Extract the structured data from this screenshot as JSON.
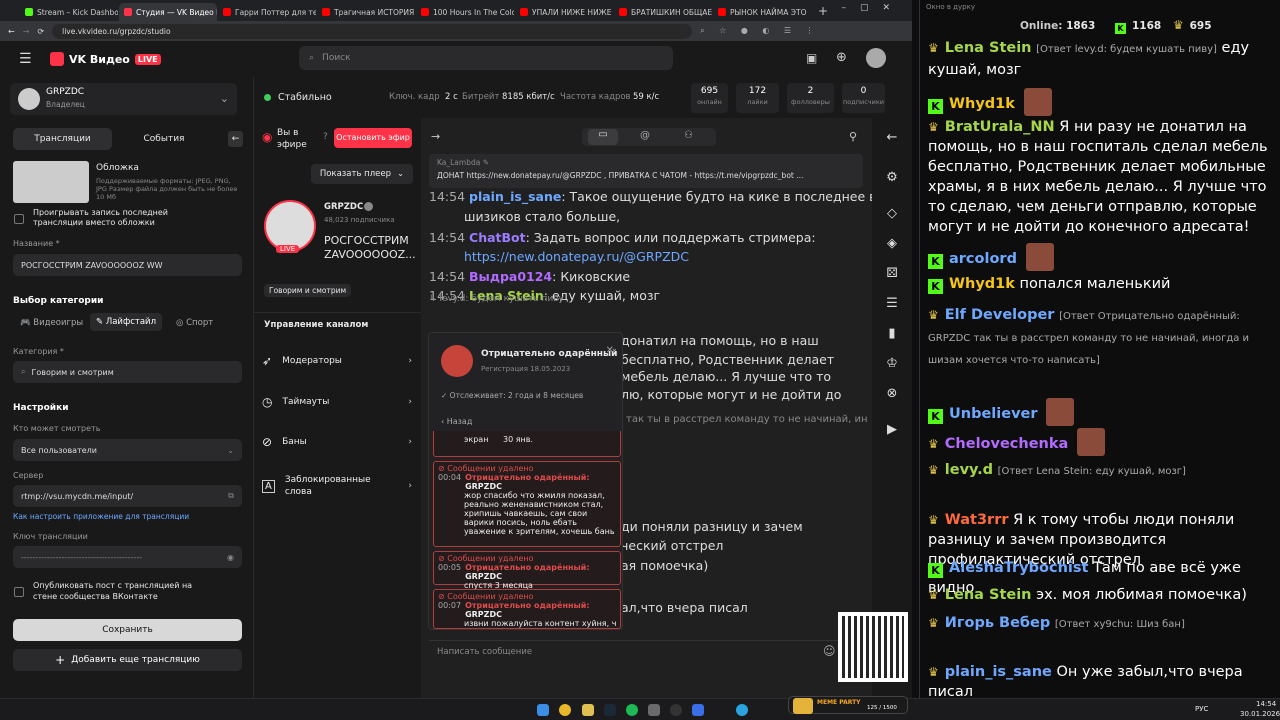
{
  "browser": {
    "tabs": [
      {
        "label": "Stream – Kick Dashboard",
        "color": "#53fc18"
      },
      {
        "label": "Студия — VK Видео Live",
        "color": "#ff3347",
        "active": true
      },
      {
        "label": "Гарри Поттер для тех",
        "color": "#ff0000"
      },
      {
        "label": "Трагичная ИСТОРИЯ",
        "color": "#ff0000"
      },
      {
        "label": "100 Hours In The Colds",
        "color": "#ff0000"
      },
      {
        "label": "УПАЛИ НИЖЕ НИЖЕ",
        "color": "#ff0000"
      },
      {
        "label": "БРАТИШКИН ОБЩАЕ",
        "color": "#ff0000"
      },
      {
        "label": "РЫНОК НАЙМА ЭТО",
        "color": "#ff0000"
      }
    ],
    "url": "live.vkvideo.ru/grpzdc/studio"
  },
  "header": {
    "logo": "VK Видео",
    "live": "LIVE",
    "search_placeholder": "Поиск"
  },
  "owner": {
    "name": "GRPZDC",
    "role": "Владелец"
  },
  "left": {
    "tab_streams": "Трансляции",
    "tab_events": "События",
    "cover_title": "Обложка",
    "cover_hint": "Поддерживаемые форматы: JPEG, PNG, JPG Размер файла должен быть не более 10 Мб",
    "replay_checkbox": "Проигрывать запись последней трансляции вместо обложки",
    "name_label": "Название *",
    "name_value": "РОСГОССТРИМ ZAVOOOOOOZ WW",
    "category_section": "Выбор категории",
    "cat_games": "Видеоигры",
    "cat_life": "Лайфстайл",
    "cat_sport": "Спорт",
    "category_label": "Категория *",
    "category_value": "Говорим и смотрим",
    "settings": "Настройки",
    "who_label": "Кто может смотреть",
    "who_value": "Все пользователи",
    "server_label": "Сервер",
    "server_value": "rtmp://vsu.mycdn.me/input/",
    "setup_link": "Как настроить приложение для трансляции",
    "key_label": "Ключ трансляции",
    "key_value": "------------------------------------------",
    "publish_checkbox": "Опубликовать пост с трансляцией на стене сообщества ВКонтакте",
    "save": "Сохранить",
    "add_stream": "Добавить еще трансляцию"
  },
  "status": {
    "state": "Стабильно",
    "keyframe_label": "Ключ. кадр",
    "keyframe_value": "2 с",
    "bitrate_label": "Битрейт",
    "bitrate_value": "8185 кбит/с",
    "fps_label": "Частота кадров",
    "fps_value": "59 к/с",
    "stats": [
      {
        "value": "695",
        "label": "онлайн"
      },
      {
        "value": "172",
        "label": "лайки"
      },
      {
        "value": "2",
        "label": "фолловеры"
      },
      {
        "value": "0",
        "label": "подписчики"
      }
    ]
  },
  "mid": {
    "on_air": "Вы в эфире",
    "stop": "Остановить эфир",
    "show_player": "Показать плеер",
    "channel": "GRPZDC",
    "subs": "48,023 подписчика",
    "title": "РОСГОССТРИМ ZAVOOOOOOZ...",
    "category": "Говорим и смотрим",
    "manage": "Управление каналом",
    "menu": [
      "Модераторы",
      "Таймауты",
      "Баны",
      "Заблокированные слова"
    ]
  },
  "chat": {
    "pinned_user": "Ka_Lambda",
    "pinned_text": "ДОНАТ https://new.donatepay.ru/@GRPZDC , ПРИВАТКА С ЧАТОМ - https://t.me/vipgrpzdc_bot ...",
    "lines": [
      {
        "time": "14:54",
        "nick": "plain_is_sane",
        "color": "#6ea8ff",
        "text": "Такое ощущение будто на кике в последнее время"
      },
      {
        "time": "",
        "nick": "",
        "color": "#ddd",
        "text": "шизиков стало больше,"
      },
      {
        "time": "14:54",
        "nick": "ChatBot",
        "color": "#9b7bff",
        "text": "Задать вопрос или поддержать стримера:"
      },
      {
        "time": "",
        "nick": "",
        "color": "#ddd",
        "text": "https://new.donatepay.ru/@GRPZDC"
      },
      {
        "time": "14:54",
        "nick": "Выдра0124",
        "color": "#b26bff",
        "text": "Киковские"
      },
      {
        "time": "14:54",
        "nick": "Lena Stein",
        "color": "#a6d64a",
        "text": "еду кушай, мозг"
      },
      {
        "time": "",
        "nick": "",
        "color": "#ddd",
        "text": "донатил на помощь, но в наш"
      },
      {
        "time": "",
        "nick": "",
        "color": "#ddd",
        "text": "бесплатно, Родственник делает"
      },
      {
        "time": "",
        "nick": "",
        "color": "#ddd",
        "text": "мебель делаю... Я лучше что то"
      },
      {
        "time": "",
        "nick": "",
        "color": "#ddd",
        "text": "лю, которые могут и не дойти до"
      },
      {
        "time": "",
        "nick": "",
        "color": "#ddd",
        "text": "ди поняли разницу и зачем"
      },
      {
        "time": "",
        "nick": "",
        "color": "#ddd",
        "text": "ческий отстрел"
      },
      {
        "time": "",
        "nick": "",
        "color": "#ddd",
        "text": "ая помоечка)"
      },
      {
        "time": "",
        "nick": "",
        "color": "#ddd",
        "text": "ал,что вчера писал"
      }
    ],
    "reply_preview": "levy.d: будем кушать пиву",
    "rasstrel": "так ты в расстрел команду то не начинай, ин",
    "input_placeholder": "Написать сообщение"
  },
  "popup": {
    "user": "Отрицательно одарённый",
    "registered": "Регистрация 18.05.2023",
    "follows": "Отслеживает: 2 года и 8 месяцев",
    "back": "Назад",
    "snippet": "экран",
    "date": "30 янв.",
    "deleted": "Сообщении удалено",
    "messages": [
      {
        "time": "00:04",
        "author": "Отрицательно одарённый:",
        "owner": "GRPZDC",
        "text": "жор спасибо что жмиля показал, реально жененавистником стал, хрипишь чавкаешь, сам свои варики посись, ноль ебать уважение к зрителям, хочешь бань"
      },
      {
        "time": "00:05",
        "author": "Отрицательно одарённый:",
        "owner": "GRPZDC",
        "text": "спустя 3 месяца"
      },
      {
        "time": "00:07",
        "author": "Отрицательно одарённый:",
        "owner": "GRPZDC",
        "text": "извни пожалуйста контент хуйня, чел ебаный любой стрим включи,"
      }
    ]
  },
  "right": {
    "window_title": "Окно в дурку",
    "online_label": "Online:",
    "online": "1863",
    "kick_count": "1168",
    "vk_count": "695",
    "messages": [
      {
        "nick": "Lena Stein",
        "color": "#a6d64a",
        "badge": "crown",
        "reply": "[Ответ levy.d: будем кушать пиву]",
        "text": "еду кушай, мозг"
      },
      {
        "nick": "Whyd1k",
        "color": "#f5c518",
        "badge": "kick",
        "reply": "",
        "text": ""
      },
      {
        "nick": "BratUrala_NN",
        "color": "#a6d64a",
        "badge": "crown",
        "reply": "",
        "text": "Я ни разу не донатил на помощь, но в наш госпиталь сделал мебель бесплатно, Родственник делает мобильные храмы, я в них мебель делаю... Я лучше что то сделаю, чем деньги отправлю, которые могут и не дойти до конечного адресата!"
      },
      {
        "nick": "arcolord",
        "color": "#6ea8ff",
        "badge": "kick",
        "reply": "",
        "text": ""
      },
      {
        "nick": "Whyd1k",
        "color": "#f5c518",
        "badge": "kick",
        "reply": "",
        "text": "попался маленький"
      },
      {
        "nick": "Elf Developer",
        "color": "#6ea8ff",
        "badge": "crown",
        "reply": "[Ответ Отрицательно одарённый: GRPZDC так ты в расстрел команду то не начинай, иногда и шизам хочется что-то написать]",
        "text": ""
      },
      {
        "nick": "Unbeliever",
        "color": "#6ea8ff",
        "badge": "kick",
        "reply": "",
        "text": ""
      },
      {
        "nick": "Chelovechenka",
        "color": "#b26bff",
        "badge": "crown",
        "reply": "",
        "text": ""
      },
      {
        "nick": "levy.d",
        "color": "#a6d64a",
        "badge": "crown",
        "reply": "[Ответ Lena Stein: еду кушай, мозг]",
        "text": ""
      },
      {
        "nick": "Wat3rrr",
        "color": "#ff6a3d",
        "badge": "crown",
        "reply": "",
        "text": "Я к тому чтобы люди поняли разницу и зачем производится профилактический отстрел"
      },
      {
        "nick": "AleshaTrybochist",
        "color": "#6ea8ff",
        "badge": "kick",
        "reply": "",
        "text": "Там по аве всё уже видно"
      },
      {
        "nick": "Lena Stein",
        "color": "#a6d64a",
        "badge": "crown",
        "reply": "",
        "text": "эх. моя любимая помоечка)"
      },
      {
        "nick": "Игорь Вебер",
        "color": "#6ea8ff",
        "badge": "crown",
        "reply": "[Ответ xy9chu: Шиз бан]",
        "text": ""
      },
      {
        "nick": "plain_is_sane",
        "color": "#6ea8ff",
        "badge": "crown",
        "reply": "",
        "text": "Он уже забыл,что вчера писал"
      }
    ]
  },
  "overlay": {
    "meme_party": "MEME PARTY",
    "progress_text": "125 / 1500"
  },
  "taskbar": {
    "lang": "РУС",
    "time": "14:54",
    "date": "30.01.2026"
  }
}
